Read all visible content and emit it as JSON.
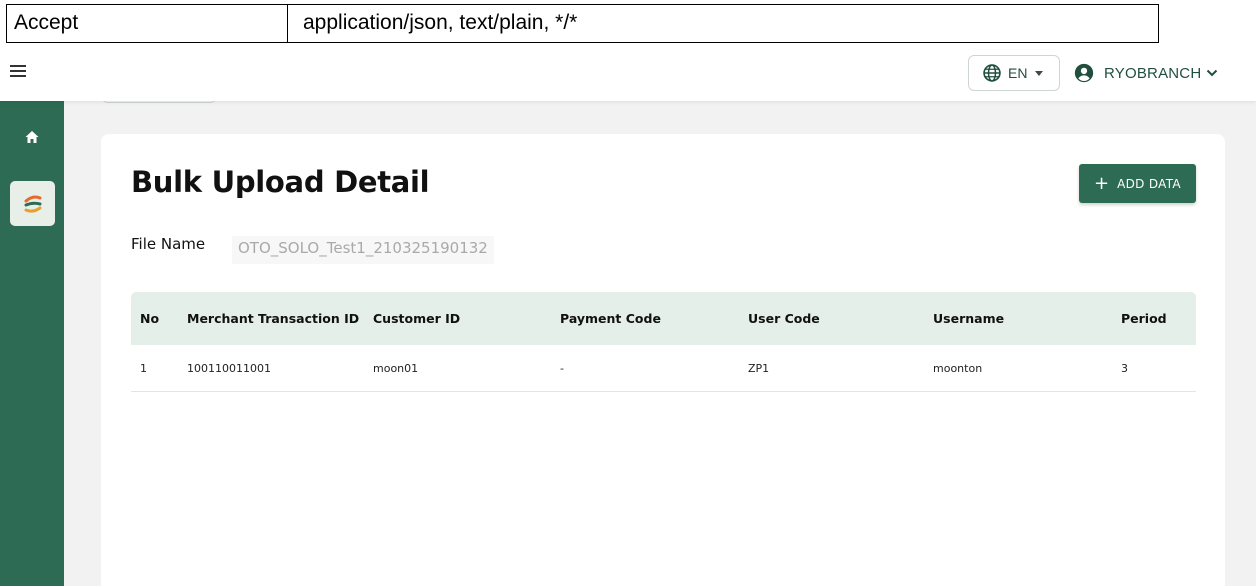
{
  "header_table": {
    "key": "Accept",
    "value": "application/json, text/plain, */*"
  },
  "topbar": {
    "language": "EN",
    "user": "RYOBRANCH"
  },
  "page": {
    "title": "Bulk Upload Detail",
    "add_button_label": "ADD DATA",
    "add_button_icon": "+",
    "file_name_label": "File Name",
    "file_name_value": "OTO_SOLO_Test1_210325190132"
  },
  "table": {
    "columns": [
      "No",
      "Merchant Transaction ID",
      "Customer ID",
      "Payment Code",
      "User Code",
      "Username",
      "Period"
    ],
    "rows": [
      [
        "1",
        "100110011001",
        "moon01",
        "-",
        "ZP1",
        "moonton",
        "3"
      ]
    ]
  },
  "colors": {
    "brand_green": "#2d6b55",
    "table_header_bg": "#e4efe9",
    "main_bg": "#f1f2f1"
  },
  "icons": {
    "menu": "hamburger-menu-icon",
    "language": "globe-icon",
    "user": "user-circle-icon",
    "home": "home-icon",
    "app": "app-logo-icon"
  }
}
